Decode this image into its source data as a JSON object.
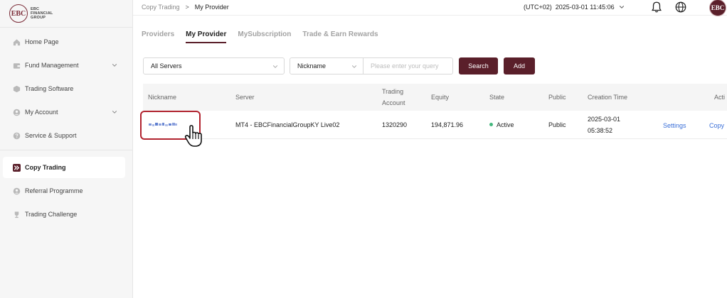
{
  "brand": {
    "logo_text": "EBC",
    "line1": "EBC",
    "line2": "FINANCIAL",
    "line3": "GROUP"
  },
  "sidebar": {
    "items": [
      {
        "label": "Home Page",
        "icon": "home-icon"
      },
      {
        "label": "Fund Management",
        "icon": "wallet-icon",
        "expandable": true
      },
      {
        "label": "Trading Software",
        "icon": "cube-icon"
      },
      {
        "label": "My Account",
        "icon": "user-icon",
        "expandable": true
      },
      {
        "label": "Service & Support",
        "icon": "help-icon"
      },
      {
        "label": "Copy Trading",
        "icon": "copy-trading-icon",
        "active": true
      },
      {
        "label": "Referral Programme",
        "icon": "referral-icon"
      },
      {
        "label": "Trading Challenge",
        "icon": "trophy-icon"
      }
    ]
  },
  "topbar": {
    "breadcrumb": [
      "Copy Trading",
      "My Provider"
    ],
    "breadcrumb_sep": ">",
    "timezone": "(UTC+02)  2025-03-01 11:45:06",
    "avatar_text": "EBC"
  },
  "tabs": [
    {
      "label": "Providers",
      "active": false
    },
    {
      "label": "My Provider",
      "active": true
    },
    {
      "label": "MySubscription",
      "active": false
    },
    {
      "label": "Trade & Earn Rewards",
      "active": false
    }
  ],
  "filters": {
    "server": "All Servers",
    "field": "Nickname",
    "query_placeholder": "Please enter your query",
    "search_label": "Search",
    "add_label": "Add"
  },
  "table": {
    "headers": {
      "nickname": "Nickname",
      "server": "Server",
      "account_line1": "Trading",
      "account_line2": "Account",
      "equity": "Equity",
      "state": "State",
      "public": "Public",
      "creation": "Creation Time",
      "action": "Acti"
    },
    "rows": [
      {
        "server": "MT4 - EBCFinancialGroupKY Live02",
        "account": "1320290",
        "equity": "194,871.96",
        "state": "Active",
        "public": "Public",
        "date": "2025-03-01",
        "time": "05:38:52",
        "settings": "Settings",
        "copy": "Copy"
      }
    ]
  },
  "colors": {
    "accent": "#5a1f2a",
    "highlight": "#b1232f",
    "link": "#3a6fd8",
    "active_dot": "#43b77d"
  }
}
